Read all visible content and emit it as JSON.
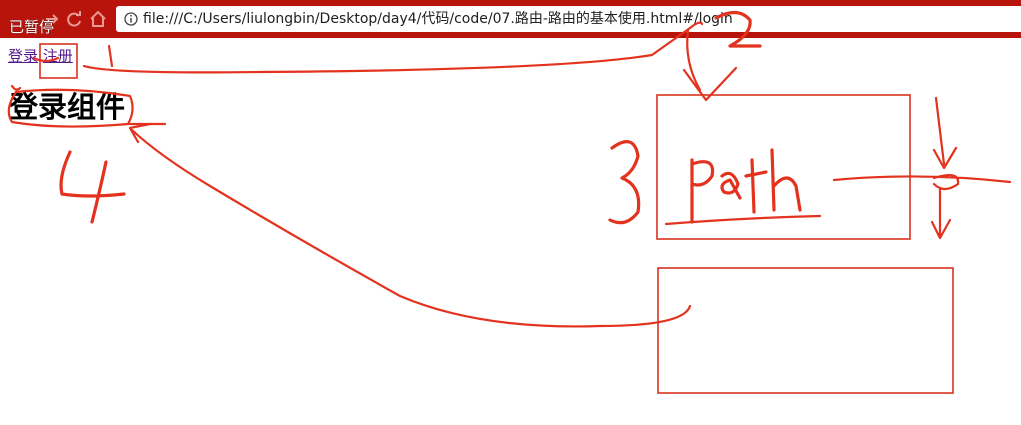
{
  "browser": {
    "status_overlay": "已暂停",
    "address": "file:///C:/Users/liulongbin/Desktop/day4/代码/code/07.路由-路由的基本使用.html#/login",
    "toolbar_color": "#b8140c"
  },
  "page": {
    "links": [
      {
        "label": "登录"
      },
      {
        "label": "注册"
      }
    ],
    "heading": "登录组件"
  },
  "annotations": {
    "color": "#e3321e",
    "handwritten_word": "path",
    "numbers": [
      "1",
      "2",
      "3",
      "4"
    ]
  }
}
